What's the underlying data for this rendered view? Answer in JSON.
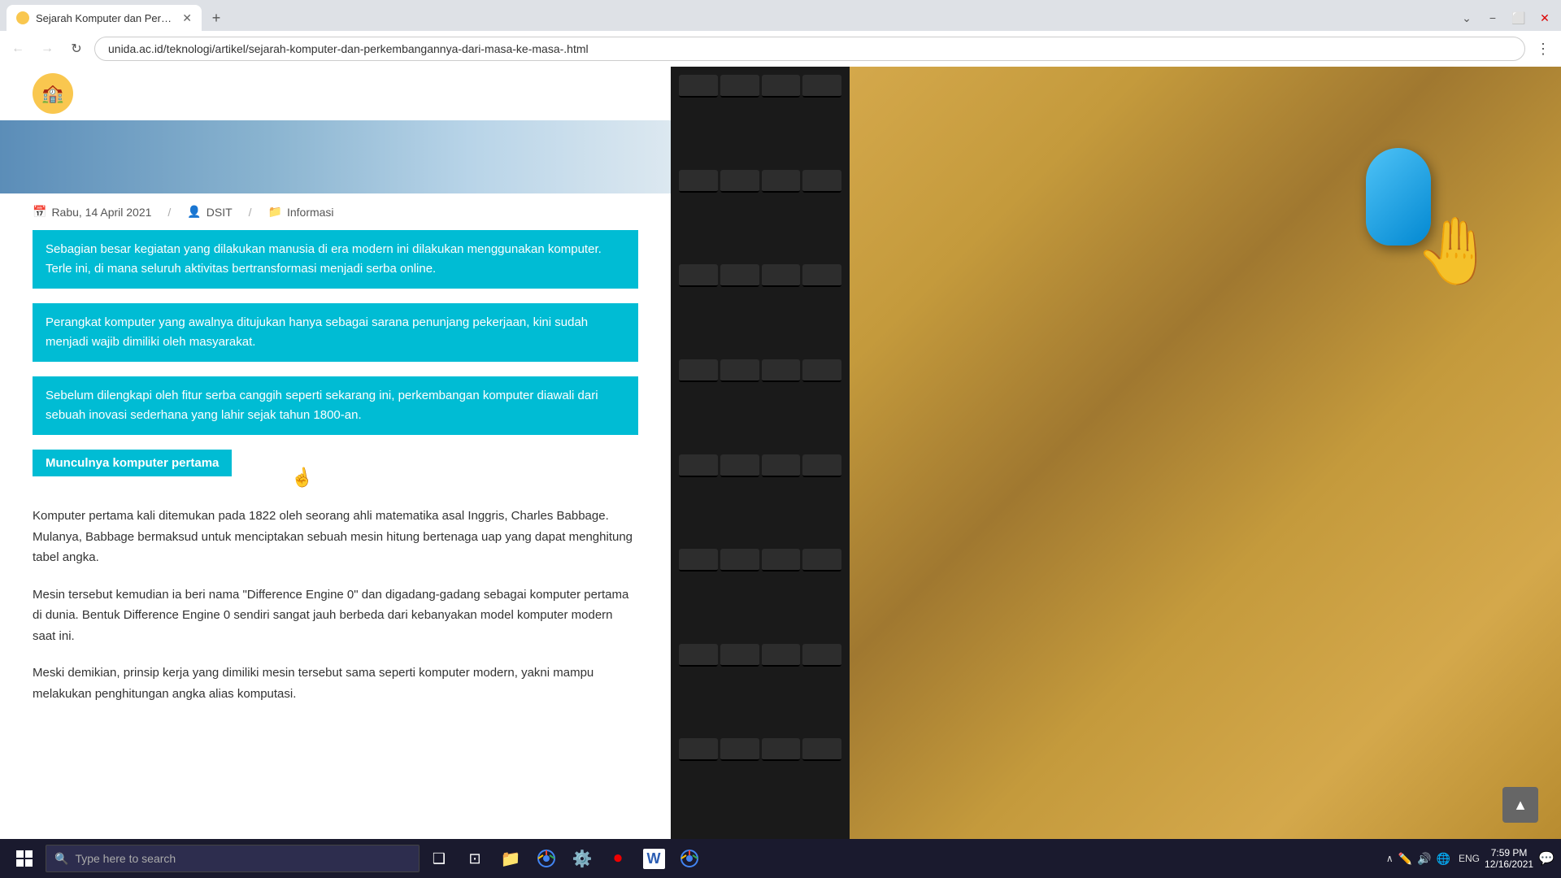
{
  "browser": {
    "tab": {
      "title": "Sejarah Komputer dan Perkemba...",
      "favicon": "🏫"
    },
    "url": "unida.ac.id/teknologi/artikel/sejarah-komputer-dan-perkembangannya-dari-masa-ke-masa-.html",
    "controls": {
      "minimize": "−",
      "maximize": "⬜",
      "close": "✕",
      "dropdown": "⌄"
    },
    "nav": {
      "back": "←",
      "forward": "→",
      "refresh": "↻",
      "menu": "⋮"
    }
  },
  "article": {
    "meta": {
      "date_icon": "📅",
      "date": "Rabu, 14 April 2021",
      "author_icon": "👤",
      "author": "DSIT",
      "category_icon": "📁",
      "category": "Informasi"
    },
    "highlighted_1": "Sebagian besar kegiatan yang dilakukan manusia di era modern ini dilakukan menggunakan komputer. Terle ini, di mana seluruh aktivitas  bertransformasi menjadi serba online.",
    "highlighted_2": "Perangkat komputer yang awalnya ditujukan hanya sebagai sarana penunjang pekerjaan, kini sudah menjadi wajib dimiliki oleh masyarakat.",
    "highlighted_3": "Sebelum dilengkapi oleh fitur serba canggih seperti sekarang ini, perkembangan komputer diawali dari sebuah inovasi sederhana yang lahir sejak tahun 1800-an.",
    "section_heading": "Munculnya komputer pertama",
    "paragraph_1": "Komputer pertama kali ditemukan pada 1822 oleh seorang ahli matematika asal Inggris, Charles Babbage. Mulanya, Babbage bermaksud untuk menciptakan sebuah mesin hitung bertenaga uap yang dapat menghitung tabel angka.",
    "paragraph_2": "Mesin tersebut kemudian ia beri nama \"Difference Engine 0\" dan digadang-gadang sebagai komputer pertama di dunia. Bentuk Difference Engine 0 sendiri sangat jauh berbeda dari kebanyakan model komputer modern saat ini.",
    "paragraph_3": "Meski demikian, prinsip kerja yang dimiliki mesin tersebut sama seperti komputer modern, yakni mampu melakukan penghitungan angka alias komputasi."
  },
  "taskbar": {
    "search_placeholder": "Type here to search",
    "time": "7:59 PM",
    "date": "12/16/2021",
    "language": "ENG",
    "icons": {
      "windows": "⊞",
      "search": "🔍",
      "task_view": "❑",
      "widgets": "⊡",
      "explorer": "📁",
      "chrome": "◉",
      "settings": "⚙",
      "record": "⏺",
      "word": "W",
      "chrome2": "◉"
    }
  },
  "scroll_to_top": "▲"
}
